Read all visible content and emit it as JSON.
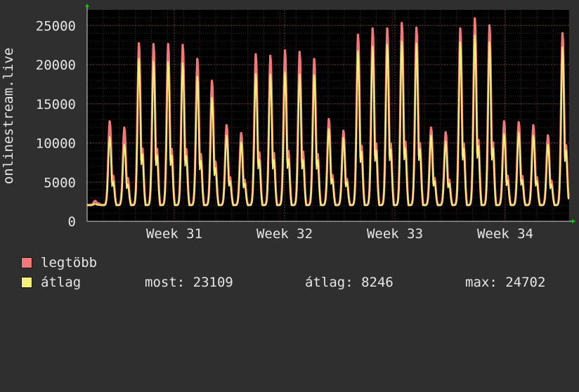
{
  "chart_data": {
    "type": "line",
    "ylabel": "onlinestream.live",
    "ylim": [
      0,
      27000
    ],
    "y_ticks": [
      0,
      5000,
      10000,
      15000,
      20000,
      25000
    ],
    "x_ticks": [
      "Week 31",
      "Week 32",
      "Week 33",
      "Week 34"
    ],
    "grid": true,
    "series": [
      {
        "name": "legtöbb",
        "color": "#f07a7a",
        "values": [
          2600,
          12800,
          12000,
          22800,
          22700,
          22700,
          22600,
          20800,
          18000,
          12300,
          11300,
          21400,
          21200,
          21900,
          21700,
          20800,
          13100,
          11600,
          23900,
          24700,
          24700,
          25400,
          24800,
          12000,
          11400,
          24700,
          26000,
          25100,
          12800,
          12700,
          12300,
          11000,
          24100
        ]
      },
      {
        "name": "átlag",
        "color": "#f4f07a",
        "values": [
          2300,
          11200,
          10200,
          21600,
          21200,
          21200,
          21000,
          19200,
          16400,
          11400,
          10500,
          19600,
          19500,
          19800,
          19500,
          19400,
          12300,
          11100,
          22600,
          23200,
          23500,
          23900,
          23600,
          11400,
          10600,
          23800,
          24700,
          23800,
          11600,
          11800,
          11400,
          10200,
          23100
        ]
      }
    ]
  },
  "legend": {
    "max_series": "legtöbb",
    "avg_series": "átlag",
    "stats": {
      "most": "most: 23109",
      "atlag": "átlag: 8246",
      "max": "max: 24702"
    }
  }
}
